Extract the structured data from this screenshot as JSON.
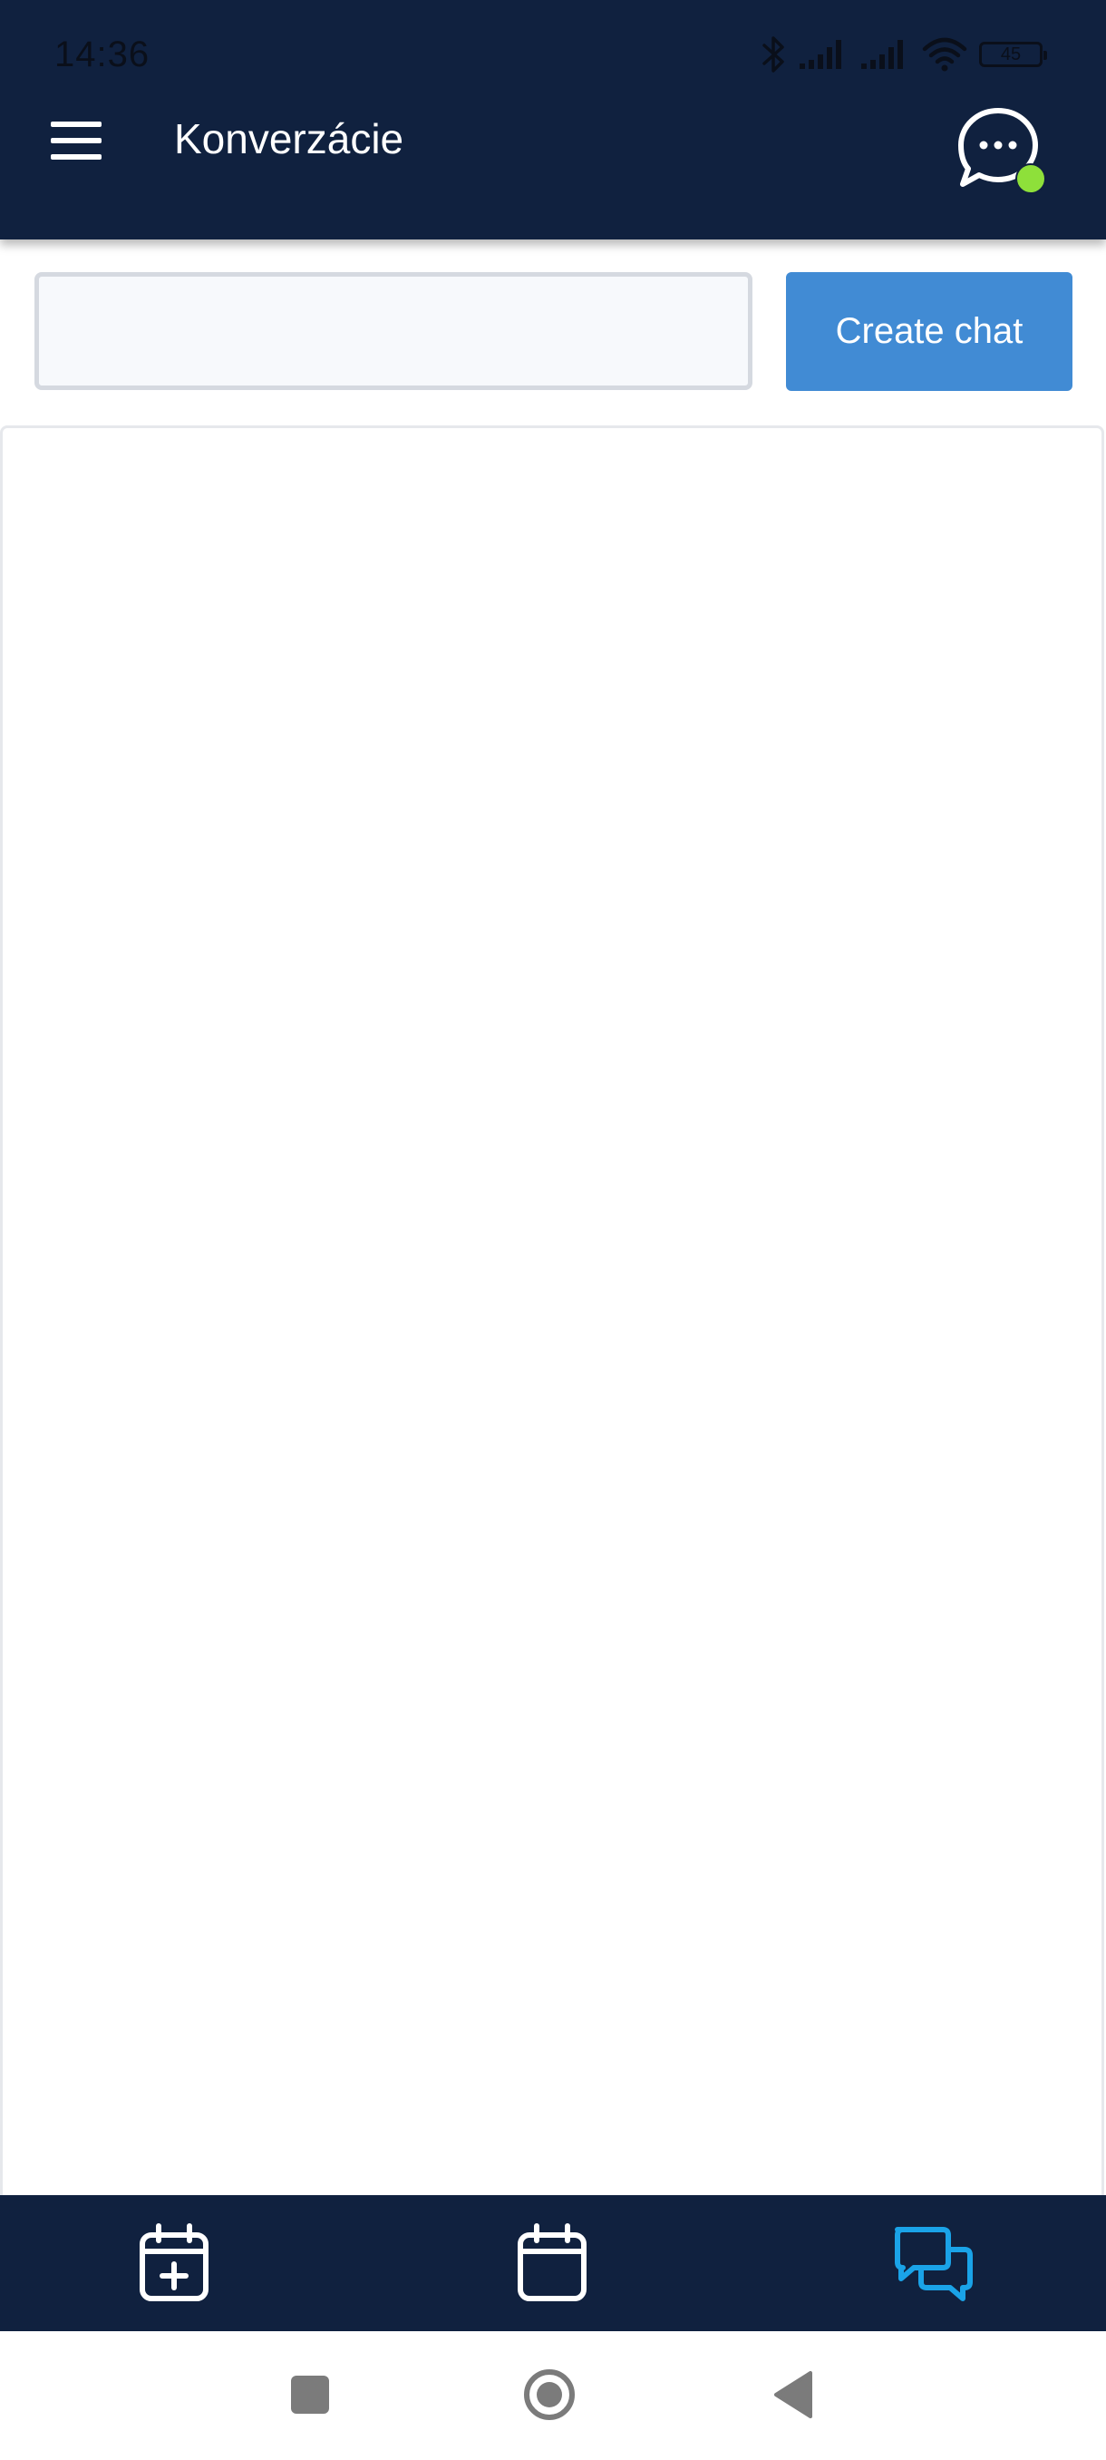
{
  "status_bar": {
    "time": "14:36",
    "battery": "45",
    "icons": [
      "bluetooth-icon",
      "signal-icon",
      "signal-icon",
      "wifi-icon",
      "battery-icon"
    ]
  },
  "header": {
    "title": "Konverzácie",
    "menu_icon": "hamburger-menu-icon",
    "chat_icon": "chat-bubble-dots-icon",
    "online_status_color": "#8ee03a"
  },
  "create_chat": {
    "input_value": "",
    "input_placeholder": "",
    "button_label": "Create chat"
  },
  "chat_list": {
    "items": []
  },
  "bottom_nav": {
    "items": [
      {
        "icon": "calendar-plus-icon",
        "active": false
      },
      {
        "icon": "calendar-icon",
        "active": false
      },
      {
        "icon": "chat-bubbles-icon",
        "active": true
      }
    ],
    "active_color": "#1aa3e8",
    "inactive_color": "#ffffff"
  },
  "system_nav": {
    "items": [
      "recent-apps-icon",
      "home-icon",
      "back-icon"
    ]
  },
  "colors": {
    "header_bg": "#10213f",
    "button_bg": "#418bd4"
  }
}
